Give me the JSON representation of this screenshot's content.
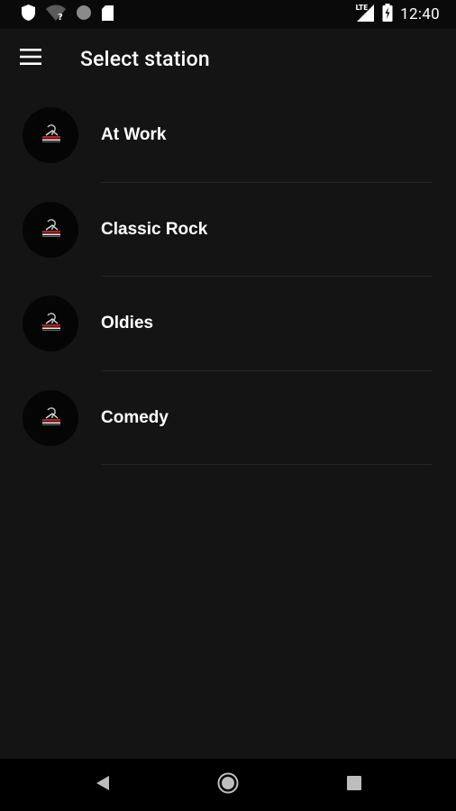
{
  "status_bar": {
    "time": "12:40",
    "network_label": "LTE",
    "icons": [
      "shield-icon",
      "wifi-unknown-icon",
      "circle-icon",
      "sd-card-icon",
      "cellular-signal-icon",
      "battery-charging-icon"
    ]
  },
  "app_bar": {
    "title": "Select station",
    "menu_icon": "hamburger-menu-icon"
  },
  "stations": [
    {
      "name": "At Work"
    },
    {
      "name": "Classic Rock"
    },
    {
      "name": "Oldies"
    },
    {
      "name": "Comedy"
    }
  ],
  "nav_bar": {
    "buttons": [
      "back-icon",
      "home-icon",
      "recents-icon"
    ]
  },
  "colors": {
    "background": "#141414",
    "status_bar": "#0a0a0a",
    "nav_bar": "#000000",
    "text": "#ffffff",
    "divider": "#262626",
    "logo_accent": "#b3231e"
  }
}
